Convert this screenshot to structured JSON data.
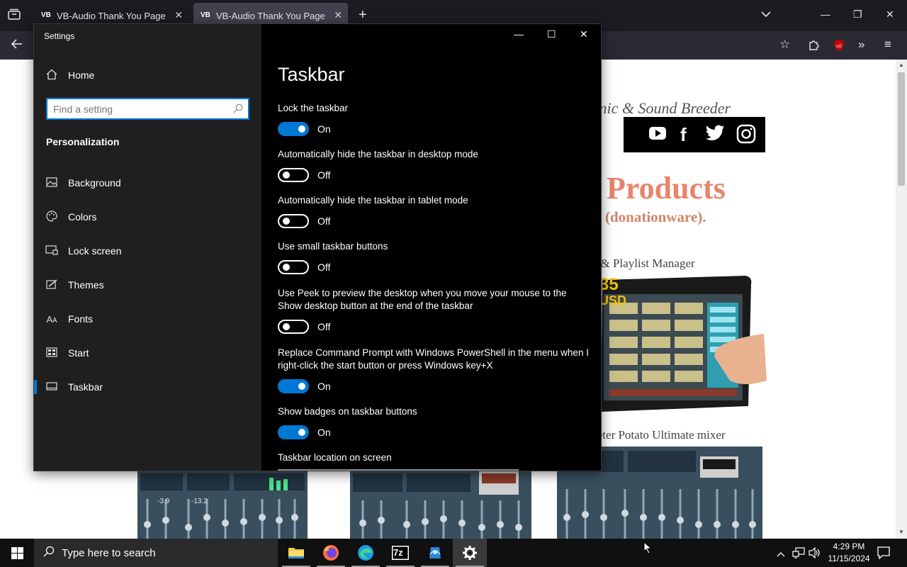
{
  "browser": {
    "tabs": [
      {
        "favicon": "VB",
        "title": "VB-Audio Thank You Page",
        "active": false
      },
      {
        "favicon": "VB",
        "title": "VB-Audio Thank You Page",
        "active": true
      }
    ],
    "new_tab_label": "+"
  },
  "webpage": {
    "tagline": "...anic & Sound Breeder",
    "heading": "Products",
    "subheading": "(donationware).",
    "product1_caption": "...d & Playlist Manager",
    "price_text_1": "35",
    "price_text_2": "USD",
    "product2_caption": "...eter Potato Ultimate mixer",
    "mixer_readouts": [
      "-3.9",
      "-13.2"
    ],
    "colors": {
      "heading": "#e8846a",
      "subheading": "#d4846a",
      "caption": "#444444"
    }
  },
  "settings": {
    "window_title": "Settings",
    "home_label": "Home",
    "search_placeholder": "Find a setting",
    "section_title": "Personalization",
    "nav": [
      {
        "label": "Background",
        "icon": "picture-icon"
      },
      {
        "label": "Colors",
        "icon": "palette-icon"
      },
      {
        "label": "Lock screen",
        "icon": "lock-screen-icon"
      },
      {
        "label": "Themes",
        "icon": "brush-icon"
      },
      {
        "label": "Fonts",
        "icon": "fonts-icon"
      },
      {
        "label": "Start",
        "icon": "start-icon"
      },
      {
        "label": "Taskbar",
        "icon": "taskbar-icon",
        "selected": true
      }
    ],
    "page_title": "Taskbar",
    "options": [
      {
        "label": "Lock the taskbar",
        "state": "On"
      },
      {
        "label": "Automatically hide the taskbar in desktop mode",
        "state": "Off"
      },
      {
        "label": "Automatically hide the taskbar in tablet mode",
        "state": "Off"
      },
      {
        "label": "Use small taskbar buttons",
        "state": "Off"
      },
      {
        "label": "Use Peek to preview the desktop when you move your mouse to the Show desktop button at the end of the taskbar",
        "state": "Off"
      },
      {
        "label": "Replace Command Prompt with Windows PowerShell in the menu when I right-click the start button or press Windows key+X",
        "state": "On"
      },
      {
        "label": "Show badges on taskbar buttons",
        "state": "On"
      }
    ],
    "location_label": "Taskbar location on screen",
    "accent_color": "#0078d4"
  },
  "taskbar": {
    "search_placeholder": "Type here to search",
    "apps": [
      "file-explorer-icon",
      "firefox-icon",
      "edge-icon",
      "7zip-icon",
      "app-icon",
      "settings-gear-icon"
    ],
    "app_7zip_label": "7z",
    "time": "4:29 PM",
    "date": "11/15/2024"
  }
}
